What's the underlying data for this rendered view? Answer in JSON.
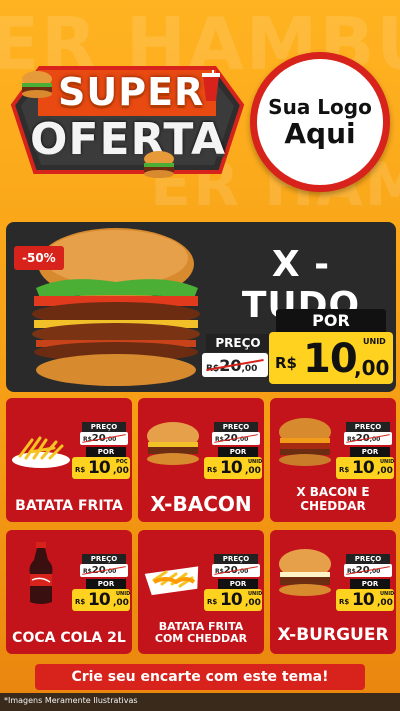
{
  "background": {
    "accent_color": "#f7a51b",
    "red_color": "#c4141b",
    "yellow_color": "#ffd21f"
  },
  "header": {
    "title_line1": "SUPER",
    "title_line2": "OFERTA",
    "logo_line1": "Sua Logo",
    "logo_line2": "Aqui"
  },
  "hero": {
    "discount": "-50%",
    "name": "X - TUDO",
    "price_label": "PREÇO",
    "old_price_int": "20",
    "old_price_dec": ",00",
    "old_price_prefix": "R$",
    "por_label": "POR",
    "currency": "R$",
    "price_int": "10",
    "price_dec": ",00",
    "unit": "UNID"
  },
  "products": [
    {
      "name": "BATATA FRITA",
      "icon": "fries-icon",
      "price_label": "PREÇO",
      "old": "20",
      "old_dec": ",00",
      "old_prefix": "R$",
      "por": "POR",
      "currency": "R$",
      "int": "10",
      "dec": ",00",
      "unit": "POÇ"
    },
    {
      "name": "X-BACON",
      "icon": "burger-icon",
      "price_label": "PREÇO",
      "old": "20",
      "old_dec": ",00",
      "old_prefix": "R$",
      "por": "POR",
      "currency": "R$",
      "int": "10",
      "dec": ",00",
      "unit": "UNID"
    },
    {
      "name": "X BACON E CHEDDAR",
      "icon": "burger-icon",
      "price_label": "PREÇO",
      "old": "20",
      "old_dec": ",00",
      "old_prefix": "R$",
      "por": "POR",
      "currency": "R$",
      "int": "10",
      "dec": ",00",
      "unit": "UNID"
    },
    {
      "name": "COCA COLA 2L",
      "icon": "soda-bottle-icon",
      "price_label": "PREÇO",
      "old": "20",
      "old_dec": ",00",
      "old_prefix": "R$",
      "por": "POR",
      "currency": "R$",
      "int": "10",
      "dec": ",00",
      "unit": "UNID"
    },
    {
      "name": "BATATA FRITA COM CHEDDAR",
      "icon": "fries-cheddar-icon",
      "price_label": "PREÇO",
      "old": "20",
      "old_dec": ",00",
      "old_prefix": "R$",
      "por": "POR",
      "currency": "R$",
      "int": "10",
      "dec": ",00",
      "unit": "UNID"
    },
    {
      "name": "X-BURGUER",
      "icon": "burger-icon",
      "price_label": "PREÇO",
      "old": "20",
      "old_dec": ",00",
      "old_prefix": "R$",
      "por": "POR",
      "currency": "R$",
      "int": "10",
      "dec": ",00",
      "unit": "UNID"
    }
  ],
  "cta": {
    "label": "Crie seu encarte com este tema!"
  },
  "footer": {
    "disclaimer": "*Imagens Meramente Ilustrativas"
  }
}
